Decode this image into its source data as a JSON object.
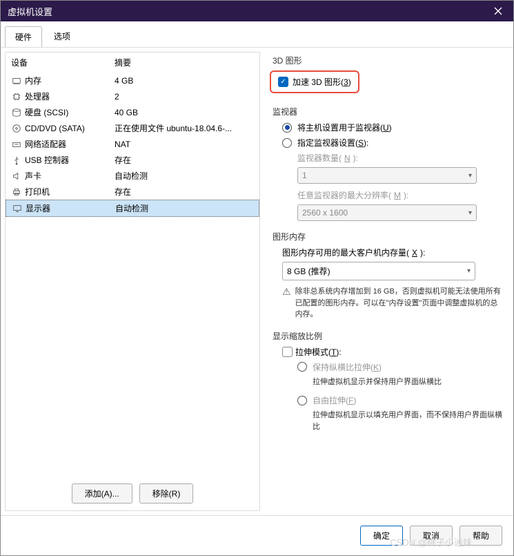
{
  "window": {
    "title": "虚拟机设置"
  },
  "tabs": {
    "hardware": "硬件",
    "options": "选项"
  },
  "deviceHeader": {
    "device": "设备",
    "summary": "摘要"
  },
  "devices": [
    {
      "icon": "memory",
      "name": "内存",
      "summary": "4 GB"
    },
    {
      "icon": "cpu",
      "name": "处理器",
      "summary": "2"
    },
    {
      "icon": "disk",
      "name": "硬盘 (SCSI)",
      "summary": "40 GB"
    },
    {
      "icon": "cd",
      "name": "CD/DVD (SATA)",
      "summary": "正在使用文件 ubuntu-18.04.6-..."
    },
    {
      "icon": "net",
      "name": "网络适配器",
      "summary": "NAT"
    },
    {
      "icon": "usb",
      "name": "USB 控制器",
      "summary": "存在"
    },
    {
      "icon": "sound",
      "name": "声卡",
      "summary": "自动检测"
    },
    {
      "icon": "printer",
      "name": "打印机",
      "summary": "存在"
    },
    {
      "icon": "display",
      "name": "显示器",
      "summary": "自动检测"
    }
  ],
  "leftButtons": {
    "add": "添加(A)...",
    "remove": "移除(R)"
  },
  "g3d": {
    "title": "3D 图形",
    "accel": "加速 3D 图形(",
    "accelKey": "3",
    "accelEnd": ")"
  },
  "monitor": {
    "title": "监视器",
    "useHost": "将主机设置用于监视器(",
    "useHostKey": "U",
    "useHostEnd": ")",
    "specify": "指定监视器设置(",
    "specifyKey": "S",
    "specifyEnd": "):",
    "count": "监视器数量(",
    "countKey": "N",
    "countEnd": "):",
    "countValue": "1",
    "maxRes": "任意监视器的最大分辨率(",
    "maxResKey": "M",
    "maxResEnd": "):",
    "maxResValue": "2560 x 1600"
  },
  "gmem": {
    "title": "图形内存",
    "label": "图形内存可用的最大客户机内存量(",
    "labelKey": "X",
    "labelEnd": "):",
    "value": "8 GB (推荐)",
    "warn": "除非总系统内存增加到 16 GB，否则虚拟机可能无法使用所有已配置的图形内存。可以在\"内存设置\"页面中调整虚拟机的总内存。"
  },
  "scale": {
    "title": "显示缩放比例",
    "stretch": "拉伸模式(",
    "stretchKey": "T",
    "stretchEnd": "):",
    "keepRatio": "保持纵横比拉伸(",
    "keepRatioKey": "K",
    "keepRatioEnd": ")",
    "keepRatioDesc": "拉伸虚拟机显示并保持用户界面纵横比",
    "free": "自由拉伸(",
    "freeKey": "F",
    "freeEnd": ")",
    "freeDesc": "拉伸虚拟机显示以填充用户界面，而不保持用户界面纵横比"
  },
  "footer": {
    "ok": "确定",
    "cancel": "取消",
    "help": "帮助"
  },
  "watermark": "CSDN @桃子小迷妹"
}
